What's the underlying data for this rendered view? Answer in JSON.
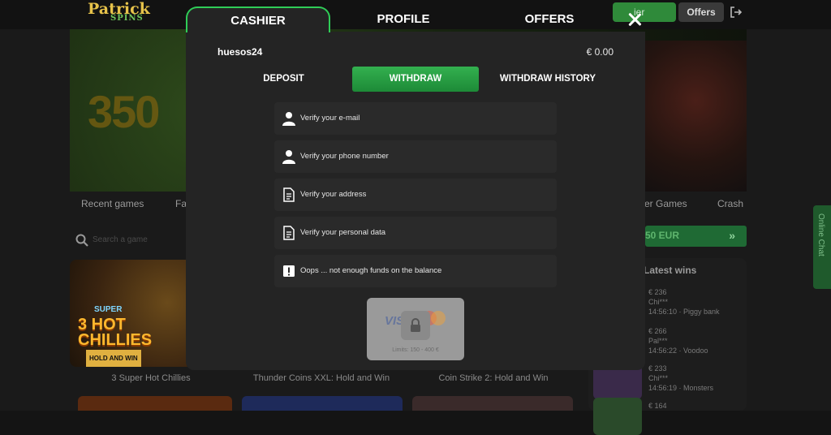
{
  "background": {
    "logo_top": "Patrick",
    "logo_bottom": "SPINS",
    "header_btn_green": "ier",
    "header_btn_offers": "Offers",
    "banner_number": "350",
    "nav": {
      "recent_games": "Recent games",
      "fav_partial": "Fa",
      "other_games_partial": "er Games",
      "crash": "Crash"
    },
    "search_placeholder": "Search a game",
    "promo_partial": "50 EUR",
    "latest_wins_title": "Latest wins",
    "latest_wins": [
      {
        "amount": "€ 236",
        "user": "Chi***",
        "time_game": "14:56:10 · Piggy bank"
      },
      {
        "amount": "€ 266",
        "user": "Pal***",
        "time_game": "14:56:22 · Voodoo"
      },
      {
        "amount": "€ 233",
        "user": "Chi***",
        "time_game": "14:56:19 · Monsters"
      },
      {
        "amount": "€ 164",
        "user": "",
        "time_game": ""
      }
    ],
    "online_chat": "Online Chat",
    "games": [
      {
        "label": "3 Super Hot Chillies",
        "art_title": "3 HOT CHILLIES",
        "art_top": "SUPER",
        "art_bottom": "HOLD AND WIN"
      },
      {
        "label": "Thunder Coins XXL: Hold and Win"
      },
      {
        "label": "Coin Strike 2: Hold and Win"
      }
    ]
  },
  "modal": {
    "tabs": [
      "CASHIER",
      "PROFILE",
      "OFFERS"
    ],
    "active_tab": "CASHIER",
    "username": "huesos24",
    "balance": "€ 0.00",
    "subtabs": [
      "DEPOSIT",
      "WITHDRAW",
      "WITHDRAW HISTORY"
    ],
    "active_subtab": "WITHDRAW",
    "verify_items": [
      {
        "icon": "user-icon",
        "label": "Verify your e-mail"
      },
      {
        "icon": "user-icon",
        "label": "Verify your phone number"
      },
      {
        "icon": "document-icon",
        "label": "Verify your address"
      },
      {
        "icon": "document-icon",
        "label": "Verify your personal data"
      },
      {
        "icon": "warning-icon",
        "label": "Oops ... not enough funds on the balance"
      }
    ],
    "payment": {
      "brand_visa": "VISA",
      "limits": "Limits: 150 - 400 €"
    }
  },
  "colors": {
    "accent_green": "#2fcc57",
    "modal_bg": "#242424",
    "row_bg": "#2a2a2a"
  }
}
